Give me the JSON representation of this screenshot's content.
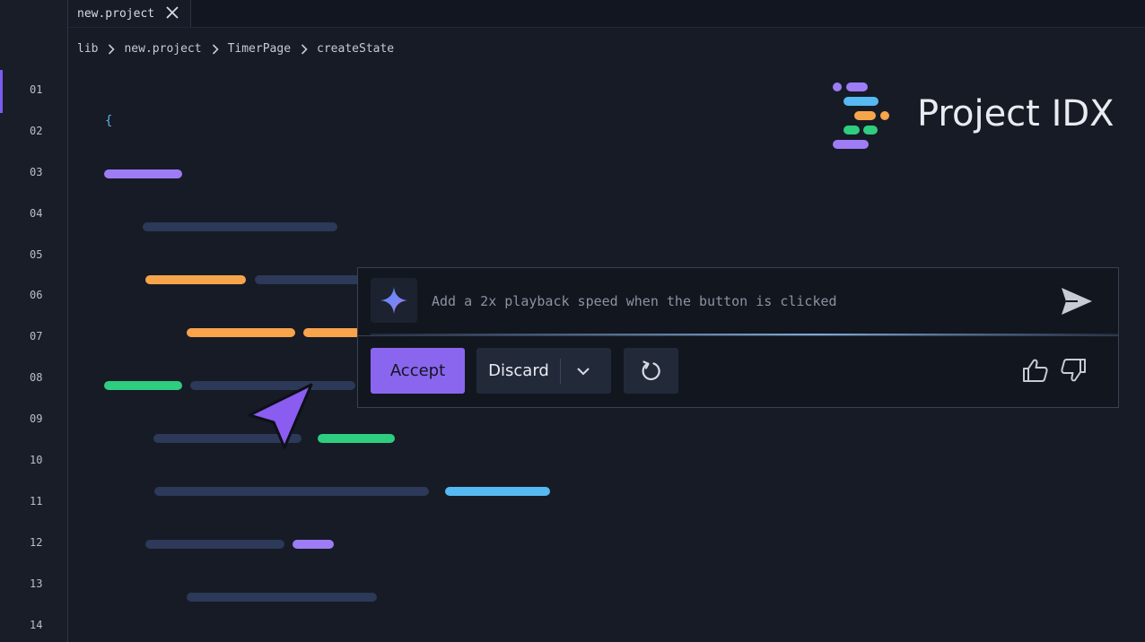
{
  "tab": {
    "label": "new.project"
  },
  "breadcrumb": [
    "lib",
    "new.project",
    "TimerPage",
    "createState"
  ],
  "line_numbers": [
    "01",
    "02",
    "03",
    "04",
    "05",
    "06",
    "07",
    "08",
    "09",
    "10",
    "11",
    "12",
    "13",
    "14"
  ],
  "code": {
    "brace": "{"
  },
  "brand": {
    "name": "Project IDX"
  },
  "assistant": {
    "placeholder": "Add a 2x playback speed when the button is clicked",
    "accept_label": "Accept",
    "discard_label": "Discard"
  },
  "icons": {
    "close": "close-icon",
    "more": "more-horizontal-icon",
    "chevron": "chevron-right-icon",
    "sparkle": "sparkle-icon",
    "send": "send-icon",
    "dropdown": "chevron-down-icon",
    "refresh": "refresh-icon",
    "like": "thumbs-up-icon",
    "dislike": "thumbs-down-icon",
    "cursor": "pointer-cursor-icon"
  },
  "colors": {
    "accent": "#8a66ee",
    "logo_purple": "#9d7cf5",
    "logo_blue": "#56b9f1",
    "logo_orange": "#f7a44b",
    "logo_green": "#2ecd7f"
  }
}
